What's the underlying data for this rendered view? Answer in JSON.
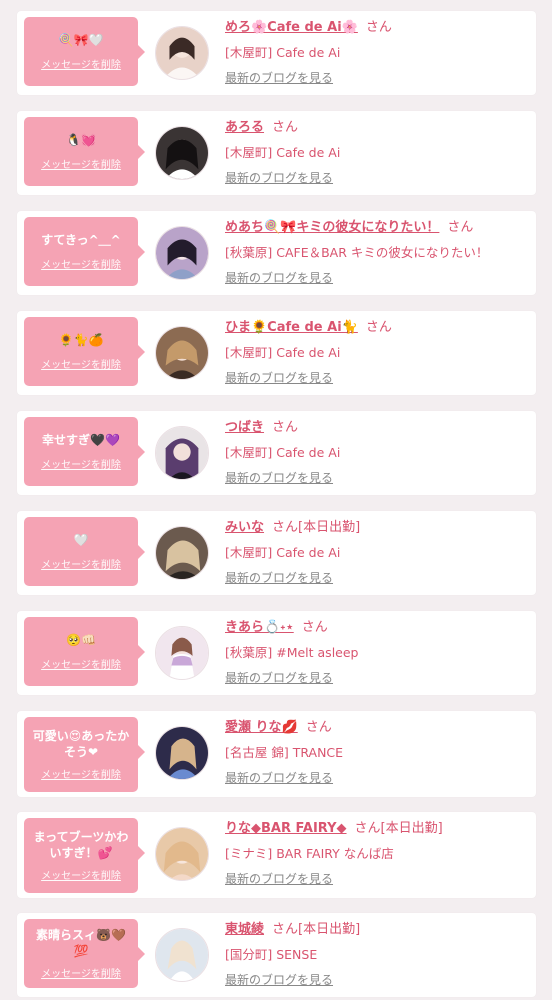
{
  "items": [
    {
      "message": "🍭🎀🤍",
      "delete_label": "メッセージを削除",
      "name": "めろ🌸Cafe de Ai🌸",
      "honorific": "さん",
      "shift": "",
      "shop": "[木屋町] Cafe de Ai",
      "blog_link": "最新のブログを見る",
      "avatar_color": "#e8d2c8"
    },
    {
      "message": "🐧💓",
      "delete_label": "メッセージを削除",
      "name": "あろる",
      "honorific": "さん",
      "shift": "",
      "shop": "[木屋町] Cafe de Ai",
      "blog_link": "最新のブログを見る",
      "avatar_color": "#3a3434"
    },
    {
      "message": "すてきっ^＿^",
      "delete_label": "メッセージを削除",
      "name": "めあち🍭🎀キミの彼女になりたい！",
      "honorific": "さん",
      "shift": "",
      "shop": "[秋葉原] CAFE＆BAR キミの彼女になりたい！",
      "blog_link": "最新のブログを見る",
      "avatar_color": "#b9a3c9"
    },
    {
      "message": "🌻🐈🍊",
      "delete_label": "メッセージを削除",
      "name": "ひま🌻Cafe de Ai🐈",
      "honorific": "さん",
      "shift": "",
      "shop": "[木屋町] Cafe de Ai",
      "blog_link": "最新のブログを見る",
      "avatar_color": "#8c6b52"
    },
    {
      "message": "幸せすぎ🖤💜",
      "delete_label": "メッセージを削除",
      "name": "つばき",
      "honorific": "さん",
      "shift": "",
      "shop": "[木屋町] Cafe de Ai",
      "blog_link": "最新のブログを見る",
      "avatar_color": "#5a3d6e"
    },
    {
      "message": "🤍",
      "delete_label": "メッセージを削除",
      "name": "みいな",
      "honorific": "さん",
      "shift": "[本日出勤]",
      "shop": "[木屋町] Cafe de Ai",
      "blog_link": "最新のブログを見る",
      "avatar_color": "#6b5a4e"
    },
    {
      "message": "🥺👊🏻",
      "delete_label": "メッセージを削除",
      "name": "きあら💍˖⋆",
      "honorific": "さん",
      "shift": "",
      "shop": "[秋葉原] #Melt asleep",
      "blog_link": "最新のブログを見る",
      "avatar_color": "#f1e6ee"
    },
    {
      "message": "可愛い😍あったかそう❤",
      "delete_label": "メッセージを削除",
      "name": "愛瀬 りな💋",
      "honorific": "さん",
      "shift": "",
      "shop": "[名古屋 錦] TRANCE",
      "blog_link": "最新のブログを見る",
      "avatar_color": "#2d2b4a"
    },
    {
      "message": "まってブーツかわいすぎ！💕",
      "delete_label": "メッセージを削除",
      "name": "りな◆BAR FAIRY◆",
      "honorific": "さん",
      "shift": "[本日出勤]",
      "shop": "[ミナミ] BAR FAIRY なんば店",
      "blog_link": "最新のブログを見る",
      "avatar_color": "#e8c9a8"
    },
    {
      "message": "素晴らスィ🐻🤎💯",
      "delete_label": "メッセージを削除",
      "name": "東城綾",
      "honorific": "さん",
      "shift": "[本日出勤]",
      "shop": "[国分町] SENSE",
      "blog_link": "最新のブログを見る",
      "avatar_color": "#dfe6ee"
    }
  ]
}
